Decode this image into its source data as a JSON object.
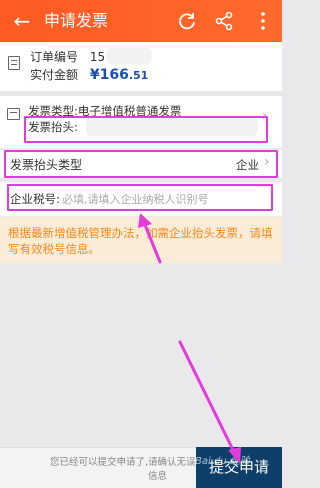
{
  "header": {
    "title": "申请发票",
    "back_icon": "back-arrow-icon",
    "refresh_icon": "refresh-icon",
    "share_icon": "share-icon",
    "more_icon": "more-vertical-icon",
    "bg_color": "#ff5a24"
  },
  "order": {
    "order_no_label": "订单编号",
    "order_no_value": "15",
    "amount_label": "实付金额",
    "amount_currency": "¥",
    "amount_int": "166",
    "amount_dec": ".51"
  },
  "invoice": {
    "type_label": "发票类型:",
    "type_value": "电子增值税普通发票",
    "title_label": "发票抬头:",
    "title_value": "",
    "header_type_label": "发票抬头类型",
    "header_type_value": "企业"
  },
  "tax": {
    "label": "企业税号:",
    "placeholder": "必填,请填入企业纳税人识别号"
  },
  "notice": {
    "text": "根据最新增值税管理办法，如需企业抬头发票，请填写有效税号信息。"
  },
  "footer": {
    "hint_line1": "您已经可以提交申请了,请确认无误",
    "hint_line2": "信息",
    "submit_label": "提交申请",
    "watermark": "Bai du 经验",
    "submit_color": "#0d3f6a"
  },
  "annotation_color": "#e33bdc"
}
